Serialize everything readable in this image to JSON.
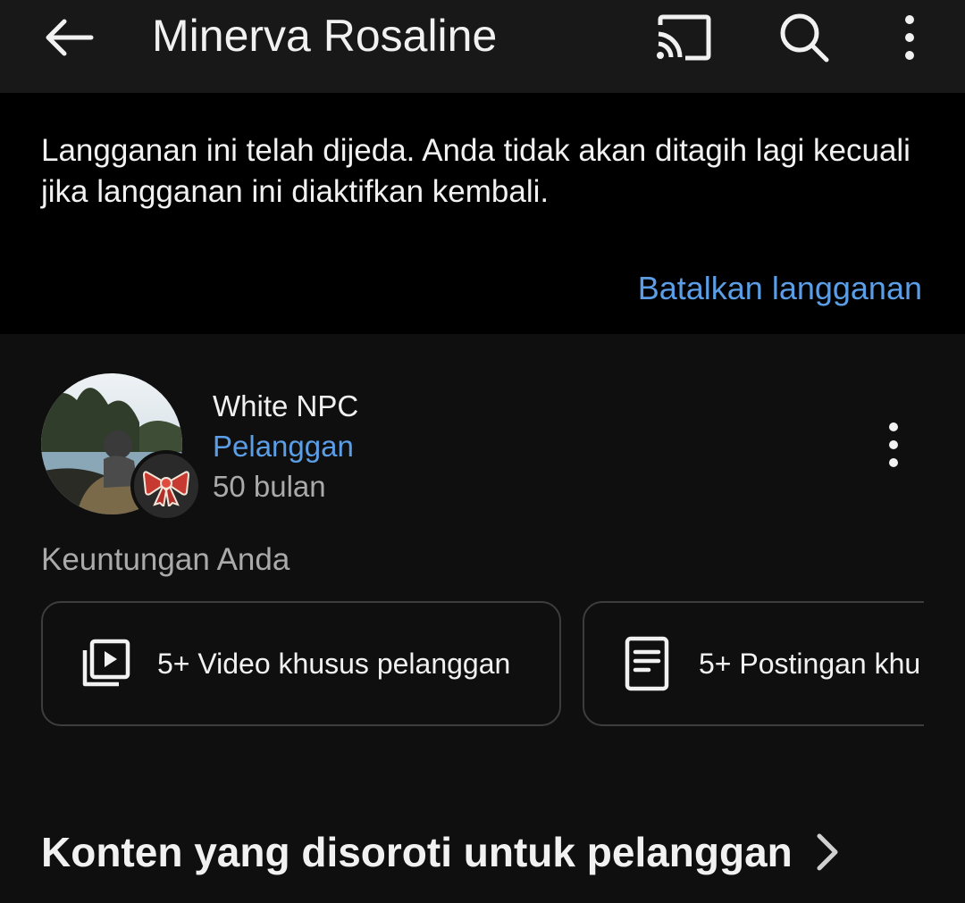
{
  "appbar": {
    "title": "Minerva Rosaline",
    "icons": [
      "back-arrow-icon",
      "cast-icon",
      "search-icon",
      "more-vertical-icon"
    ]
  },
  "banner": {
    "message": "Langganan ini telah dijeda. Anda tidak akan ditagih lagi kecuali jika langganan ini diaktifkan kembali.",
    "action_label": "Batalkan langganan",
    "action_color": "#5b9ee6"
  },
  "member": {
    "name": "White NPC",
    "status": "Pelanggan",
    "duration": "50 bulan",
    "badge_icon": "red-ribbon-bow-icon"
  },
  "benefits": {
    "heading": "Keuntungan Anda",
    "items": [
      {
        "icon": "video-library-icon",
        "label": "5+ Video khusus pelanggan"
      },
      {
        "icon": "post-document-icon",
        "label": "5+ Postingan khu"
      }
    ]
  },
  "highlighted": {
    "title": "Konten yang disoroti untuk pelanggan",
    "icon": "chevron-right-icon"
  },
  "colors": {
    "background": "#0f0f0f",
    "appbar": "#181818",
    "banner": "#000000",
    "accent_link": "#5b9ee6",
    "secondary_text": "#aaaaaa",
    "card_border": "#3d3d3d"
  }
}
